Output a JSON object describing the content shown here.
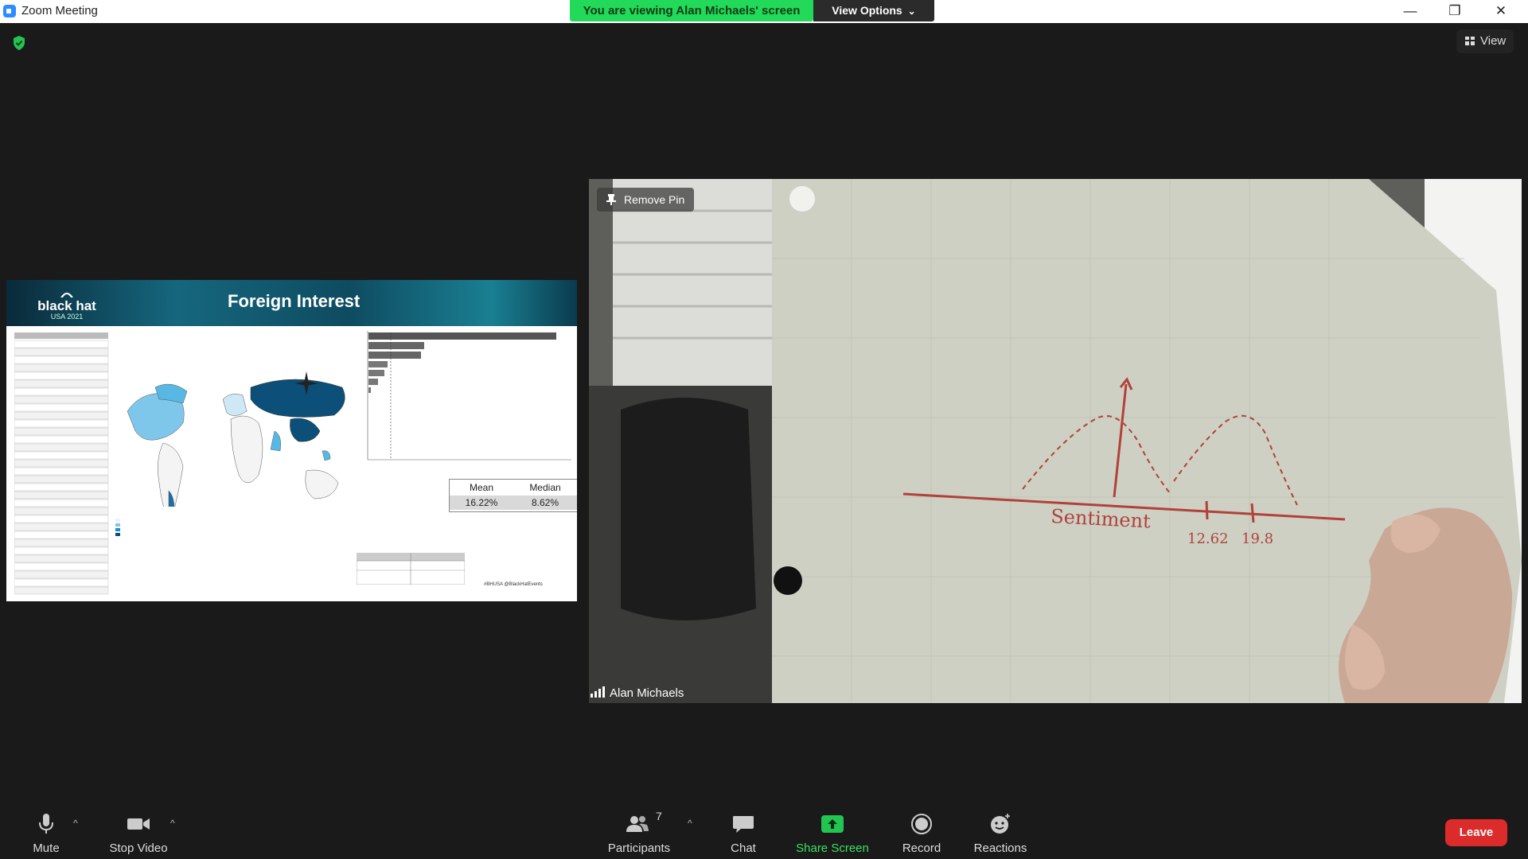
{
  "window": {
    "title": "Zoom Meeting",
    "minimize_glyph": "—",
    "restore_glyph": "❐",
    "close_glyph": "✕"
  },
  "banner": {
    "viewing_text": "You are viewing Alan Michaels' screen",
    "view_options_label": "View Options",
    "view_options_caret": "⌄"
  },
  "top_right": {
    "view_label": "View"
  },
  "shared_screen": {
    "slide_title": "Foreign Interest",
    "logo_text": "black hat",
    "logo_sub": "USA 2021",
    "stats": {
      "mean_label": "Mean",
      "median_label": "Median",
      "mean_value": "16.22%",
      "median_value": "8.62%"
    },
    "footer": "#BHUSA   @BlackHatEvents"
  },
  "video": {
    "remove_pin_label": "Remove Pin",
    "participant_name": "Alan Michaels",
    "sketch_text_1": "Sentiment",
    "sketch_text_2": "12.62",
    "sketch_text_3": "19.8"
  },
  "toolbar": {
    "mute_label": "Mute",
    "stop_video_label": "Stop Video",
    "participants_label": "Participants",
    "participants_count": "7",
    "chat_label": "Chat",
    "share_screen_label": "Share Screen",
    "record_label": "Record",
    "reactions_label": "Reactions",
    "leave_label": "Leave",
    "caret": "^"
  },
  "colors": {
    "share_green": "#3ce15f",
    "banner_green": "#23d959",
    "leave_red": "#dc2b2b",
    "sketch_red": "#c0392b"
  }
}
